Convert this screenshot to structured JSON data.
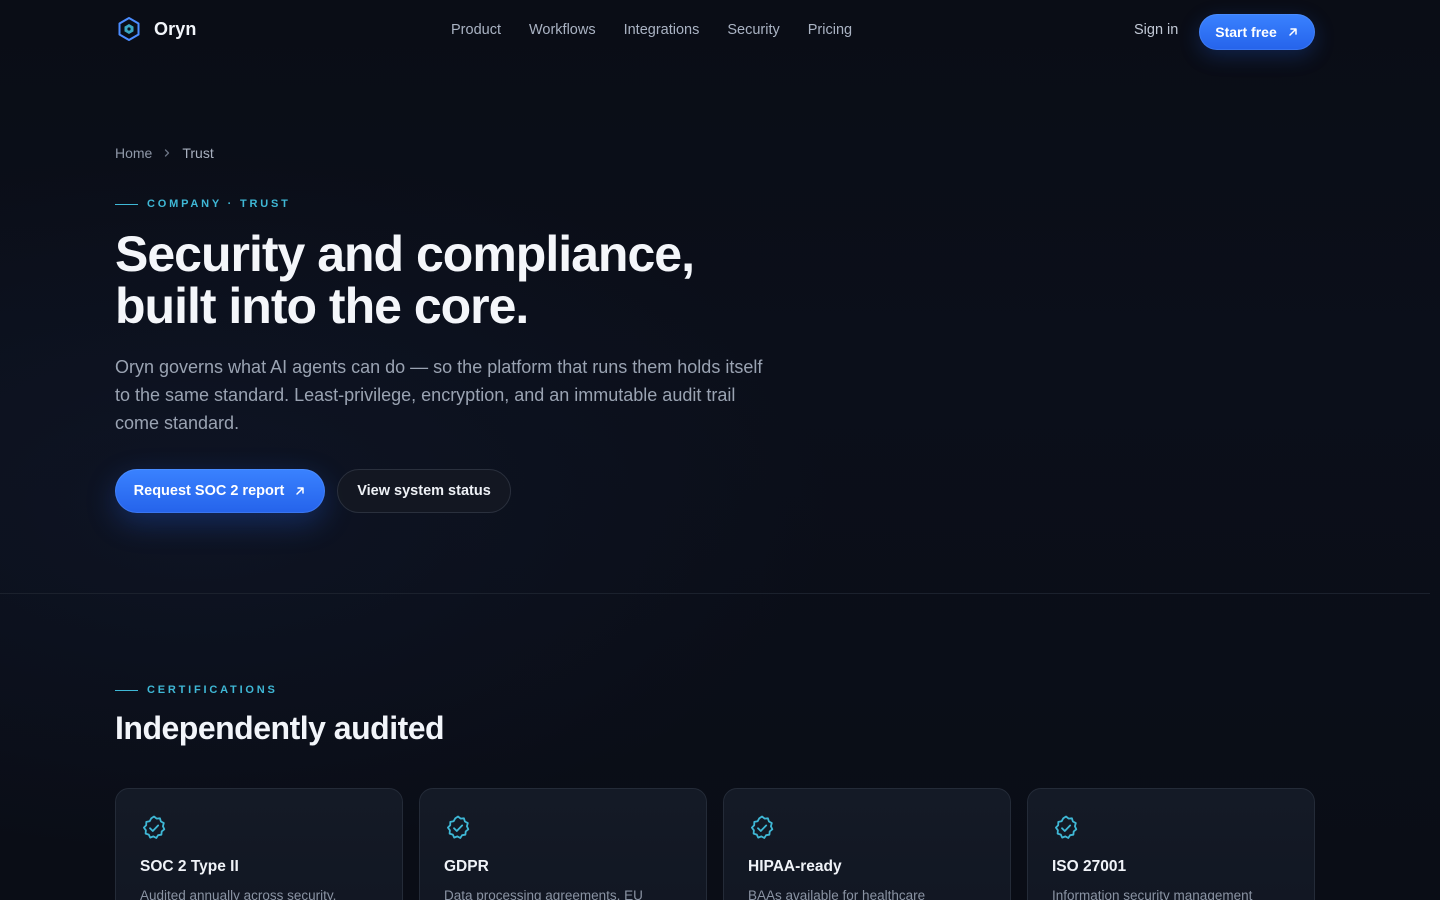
{
  "nav": {
    "logo_text": "Oryn",
    "links": [
      "Product",
      "Workflows",
      "Integrations",
      "Security",
      "Pricing"
    ],
    "sign_in": "Sign in",
    "start_free": "Start free"
  },
  "breadcrumb": {
    "home": "Home",
    "current": "Trust"
  },
  "hero": {
    "eyebrow": "COMPANY · TRUST",
    "title_line1": "Security and compliance,",
    "title_line2": "built into the core.",
    "description": "Oryn governs what AI agents can do — so the platform that runs them holds itself to the same standard. Least-privilege, encryption, and an immutable audit trail come standard.",
    "primary_cta": "Request SOC 2 report",
    "secondary_cta": "View system status"
  },
  "certifications": {
    "eyebrow": "CERTIFICATIONS",
    "title": "Independently audited",
    "cards": [
      {
        "title": "SOC 2 Type II",
        "description": "Audited annually across security,"
      },
      {
        "title": "GDPR",
        "description": "Data processing agreements, EU"
      },
      {
        "title": "HIPAA-ready",
        "description": "BAAs available for healthcare"
      },
      {
        "title": "ISO 27001",
        "description": "Information security management"
      }
    ]
  },
  "colors": {
    "background": "#0a0d16",
    "accent_blue": "#2563eb",
    "accent_cyan": "#3fb8d6"
  },
  "icons": [
    "oryn-logo-icon",
    "arrow-up-right-icon",
    "chevron-right-icon",
    "verified-badge-icon"
  ]
}
